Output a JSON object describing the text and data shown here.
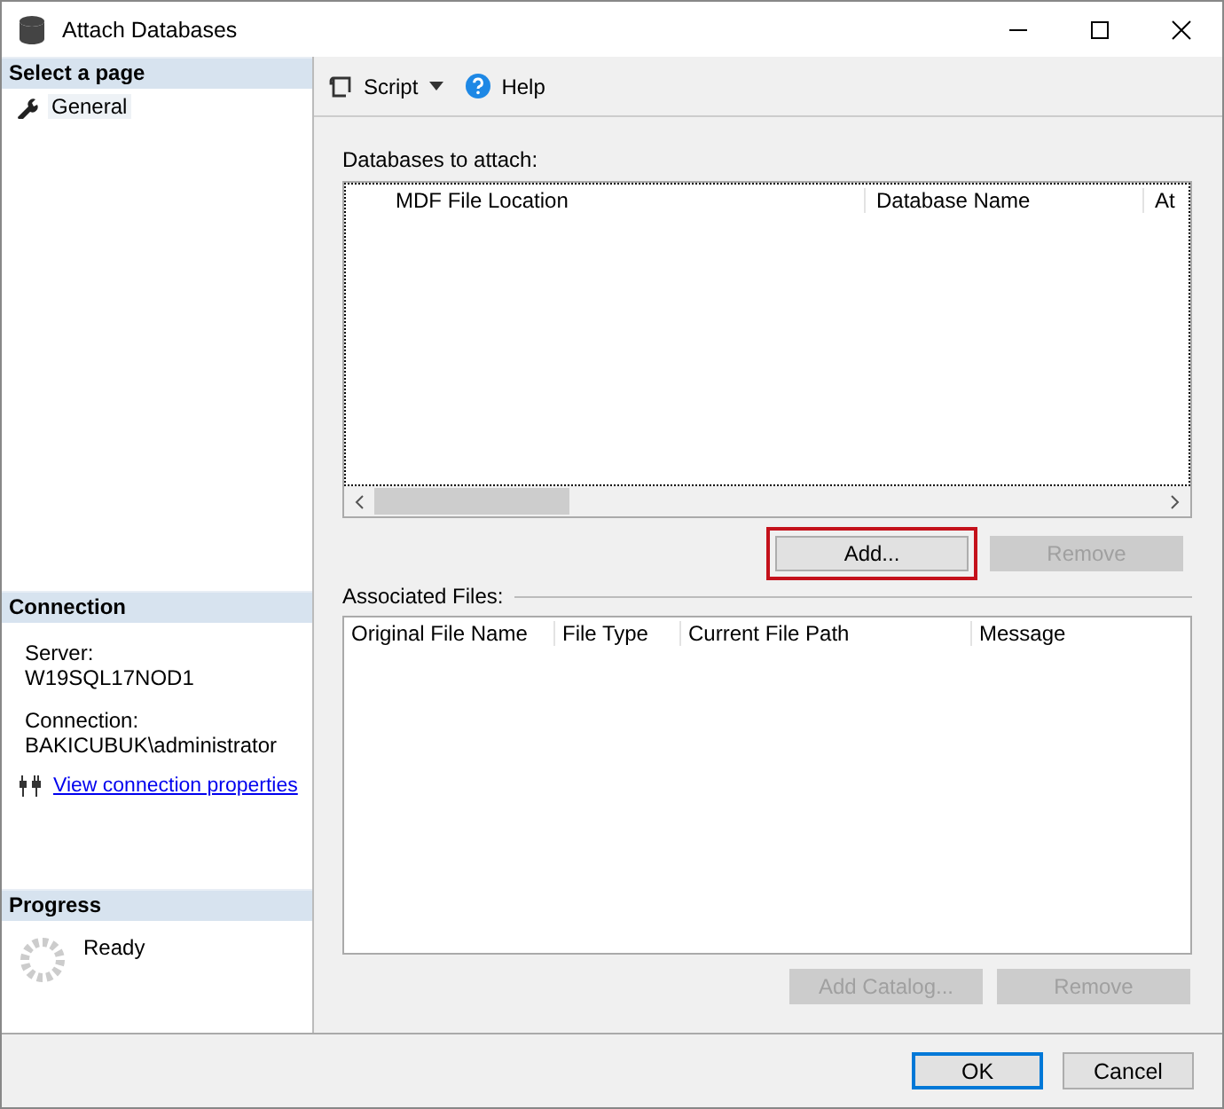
{
  "window": {
    "title": "Attach Databases"
  },
  "sidebar": {
    "pages_header": "Select a page",
    "pages": [
      {
        "label": "General",
        "selected": true
      }
    ],
    "connection": {
      "header": "Connection",
      "fields": [
        {
          "label": "Server:",
          "value": "W19SQL17NOD1"
        },
        {
          "label": "Connection:",
          "value": "BAKICUBUK\\administrator"
        }
      ],
      "link": "View connection properties"
    },
    "progress": {
      "header": "Progress",
      "status": "Ready"
    }
  },
  "toolbar": [
    {
      "kind": "script",
      "label": "Script"
    },
    {
      "kind": "help",
      "label": "Help"
    }
  ],
  "databases": {
    "label": "Databases to attach:",
    "columns": [
      "MDF File Location",
      "Database Name",
      "At"
    ],
    "buttons": [
      {
        "label": "Add...",
        "disabled": false,
        "highlighted": true
      },
      {
        "label": "Remove",
        "disabled": true,
        "highlighted": false
      }
    ]
  },
  "associated_files": {
    "label": "Associated Files:",
    "columns": [
      "Original File Name",
      "File Type",
      "Current File Path",
      "Message"
    ],
    "buttons": [
      {
        "label": "Add Catalog...",
        "disabled": true
      },
      {
        "label": "Remove",
        "disabled": true
      }
    ]
  },
  "footer_buttons": [
    {
      "label": "OK",
      "default": true
    },
    {
      "label": "Cancel",
      "default": false
    }
  ]
}
